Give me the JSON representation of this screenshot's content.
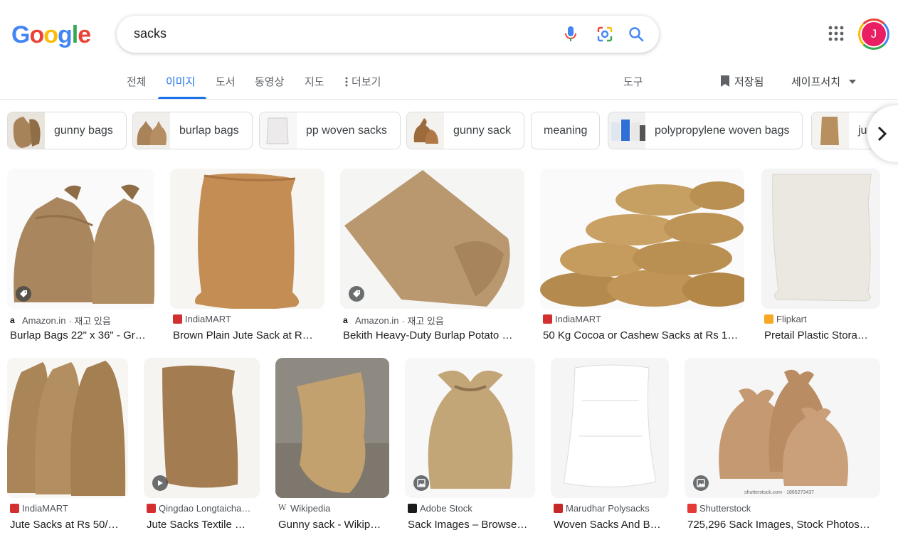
{
  "logo": {
    "letters": [
      "G",
      "o",
      "o",
      "g",
      "l",
      "e"
    ],
    "colors": [
      "#4285f4",
      "#ea4335",
      "#fbbc05",
      "#4285f4",
      "#34a853",
      "#ea4335"
    ]
  },
  "search": {
    "query": "sacks"
  },
  "avatar": {
    "initial": "J"
  },
  "tabs": [
    {
      "label": "전체"
    },
    {
      "label": "이미지",
      "active": true
    },
    {
      "label": "도서"
    },
    {
      "label": "동영상"
    },
    {
      "label": "지도"
    },
    {
      "label": "더보기"
    }
  ],
  "tools": {
    "label": "도구"
  },
  "saved": {
    "label": "저장됨"
  },
  "safesearch": {
    "label": "세이프서치"
  },
  "chips": [
    {
      "label": "gunny bags"
    },
    {
      "label": "burlap bags"
    },
    {
      "label": "pp woven sacks"
    },
    {
      "label": "gunny sack"
    },
    {
      "label": "meaning"
    },
    {
      "label": "polypropylene woven bags"
    },
    {
      "label": "ju"
    }
  ],
  "results": [
    {
      "source": "Amazon.in",
      "stock": "· 재고 있음",
      "title": "Burlap Bags 22\" x 36\" - Gr…",
      "favicon_color": "#111111"
    },
    {
      "source": "IndiaMART",
      "stock": "",
      "title": "Brown Plain Jute Sack at R…",
      "favicon_color": "#d32f2f"
    },
    {
      "source": "Amazon.in",
      "stock": "· 재고 있음",
      "title": "Bekith Heavy-Duty Burlap Potato …",
      "favicon_color": "#111111"
    },
    {
      "source": "IndiaMART",
      "stock": "",
      "title": "50 Kg Cocoa or Cashew Sacks at Rs 1…",
      "favicon_color": "#d32f2f"
    },
    {
      "source": "Flipkart",
      "stock": "",
      "title": "Pretail Plastic Stora…",
      "favicon_color": "#f9a825"
    },
    {
      "source": "IndiaMART",
      "stock": "",
      "title": "Jute Sacks at Rs 50/…",
      "favicon_color": "#d32f2f"
    },
    {
      "source": "Qingdao Longtaicha…",
      "stock": "",
      "title": "Jute Sacks Textile …",
      "favicon_color": "#d32f2f"
    },
    {
      "source": "Wikipedia",
      "stock": "",
      "title": "Gunny sack - Wikip…",
      "favicon_color": "#555555"
    },
    {
      "source": "Adobe Stock",
      "stock": "",
      "title": "Sack Images – Browse…",
      "favicon_color": "#1a1a1a"
    },
    {
      "source": "Marudhar Polysacks",
      "stock": "",
      "title": "Woven Sacks And B…",
      "favicon_color": "#c62828"
    },
    {
      "source": "Shutterstock",
      "stock": "",
      "title": "725,296 Sack Images, Stock Photos…",
      "favicon_color": "#e53935"
    }
  ],
  "watermark": "shutterstock.com · 1865273437"
}
